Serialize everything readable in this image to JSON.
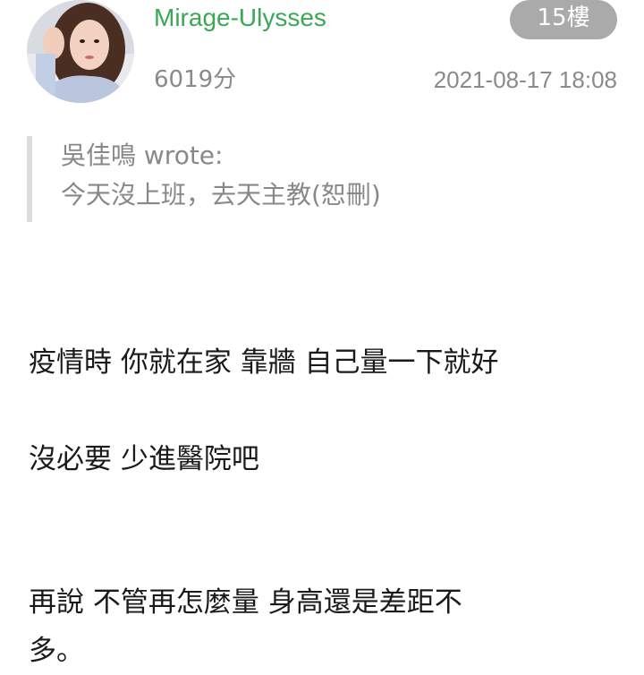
{
  "post": {
    "username": "Mirage-Ulysses",
    "floor": "15樓",
    "score": "6019分",
    "timestamp": "2021-08-17 18:08",
    "quote": {
      "author_line": "吳佳鳴 wrote:",
      "text": "今天沒上班，去天主教(恕刪)"
    },
    "paragraphs": [
      "疫情時 你就在家 靠牆 自己量一下就好",
      "沒必要 少進醫院吧",
      "再說 不管再怎麼量 身高還是差距不",
      "多。"
    ]
  },
  "colors": {
    "username": "#3aa857",
    "badge_bg": "#aaaaaa",
    "meta_text": "#8a8a8a",
    "quote_bar": "#dcdcdc"
  }
}
